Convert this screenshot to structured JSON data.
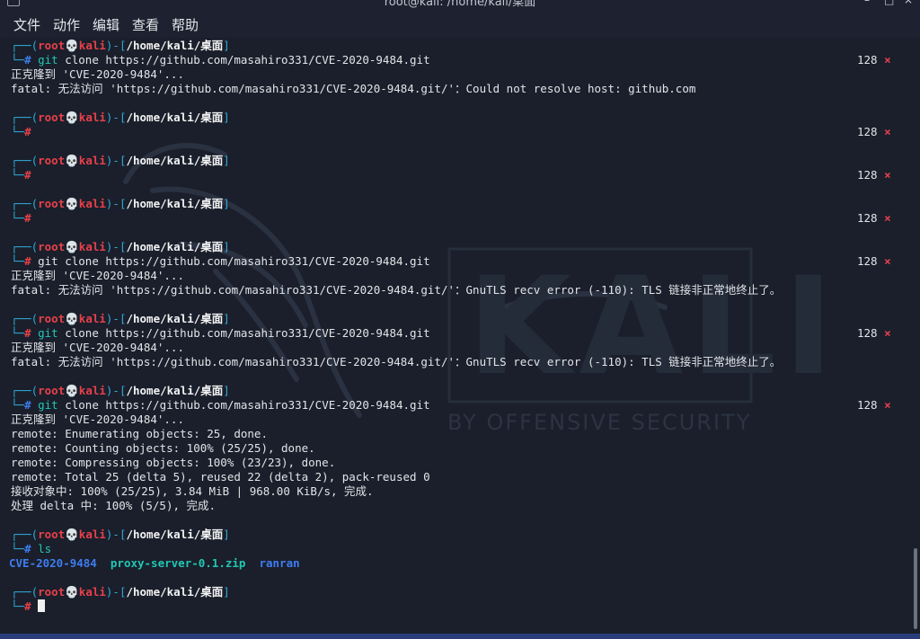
{
  "window": {
    "title": "root@kali: /home/kali/桌面",
    "controls": [
      "–",
      "□",
      "×"
    ]
  },
  "menu": [
    "文件",
    "动作",
    "编辑",
    "查看",
    "帮助"
  ],
  "prompt": {
    "user": "root",
    "skull": "💀",
    "host": "kali",
    "path": "/home/kali/桌面",
    "hash": "#",
    "corner_top": "┌──(",
    "mid": ")-[",
    "end": "]",
    "corner_bottom": "└─"
  },
  "status": {
    "code": "128",
    "mark": "×"
  },
  "commands": {
    "clone": "git clone https://github.com/masahiro331/CVE-2020-9484.git",
    "git": "git",
    "clone_rest": " clone https://github.com/masahiro331/CVE-2020-9484.git",
    "ls": "ls"
  },
  "output": {
    "cloning": "正克隆到 'CVE-2020-9484'...",
    "fatal_resolve": "fatal: 无法访问 'https://github.com/masahiro331/CVE-2020-9484.git/'：Could not resolve host: github.com",
    "fatal_tls": "fatal: 无法访问 'https://github.com/masahiro331/CVE-2020-9484.git/'：GnuTLS recv error (-110): TLS 链接非正常地终止了。",
    "remote_lines": [
      "remote: Enumerating objects: 25, done.",
      "remote: Counting objects: 100% (25/25), done.",
      "remote: Compressing objects: 100% (23/23), done.",
      "remote: Total 25 (delta 5), reused 22 (delta 2), pack-reused 0",
      "接收对象中: 100% (25/25), 3.84 MiB | 968.00 KiB/s, 完成.",
      "处理 delta 中: 100% (5/5), 完成."
    ],
    "ls_items": [
      "CVE-2020-9484",
      "proxy-server-0.1.zip",
      "ranran"
    ]
  },
  "watermark": {
    "logo": "KALI",
    "tagline": "BY OFFENSIVE SECURITY"
  }
}
